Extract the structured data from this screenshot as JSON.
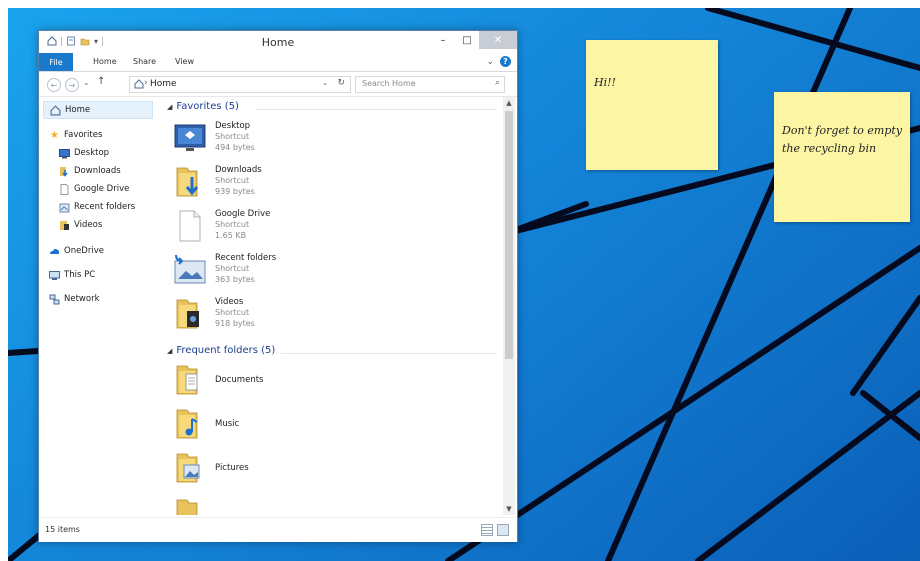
{
  "window": {
    "title": "Home",
    "minimize": "–",
    "maximize": "□",
    "close": "✕"
  },
  "ribbon": {
    "file": "File",
    "tabs": [
      "Home",
      "Share",
      "View"
    ],
    "expand": "⌄",
    "help": "?"
  },
  "address": {
    "path": "Home",
    "separator": "›",
    "search_placeholder": "Search Home",
    "refresh": "↻",
    "dropdown": "⌄",
    "back": "←",
    "forward": "→",
    "recent": "⌄",
    "up": "↑"
  },
  "nav": {
    "home": "Home",
    "favorites": "Favorites",
    "desktop": "Desktop",
    "downloads": "Downloads",
    "google_drive": "Google Drive",
    "recent_folders": "Recent folders",
    "videos": "Videos",
    "onedrive": "OneDrive",
    "this_pc": "This PC",
    "network": "Network"
  },
  "groups": {
    "favorites": "Favorites (5)",
    "frequent": "Frequent folders (5)"
  },
  "favorites": [
    {
      "name": "Desktop",
      "type": "Shortcut",
      "size": "494 bytes"
    },
    {
      "name": "Downloads",
      "type": "Shortcut",
      "size": "939 bytes"
    },
    {
      "name": "Google Drive",
      "type": "Shortcut",
      "size": "1.65 KB"
    },
    {
      "name": "Recent folders",
      "type": "Shortcut",
      "size": "363 bytes"
    },
    {
      "name": "Videos",
      "type": "Shortcut",
      "size": "918 bytes"
    }
  ],
  "frequent": [
    {
      "name": "Documents"
    },
    {
      "name": "Music"
    },
    {
      "name": "Pictures"
    }
  ],
  "status": {
    "items": "15 items"
  },
  "notes": {
    "hi": "Hi!!",
    "bin_line1": "Don't forget to empty",
    "bin_line2": "the recycling bin"
  }
}
